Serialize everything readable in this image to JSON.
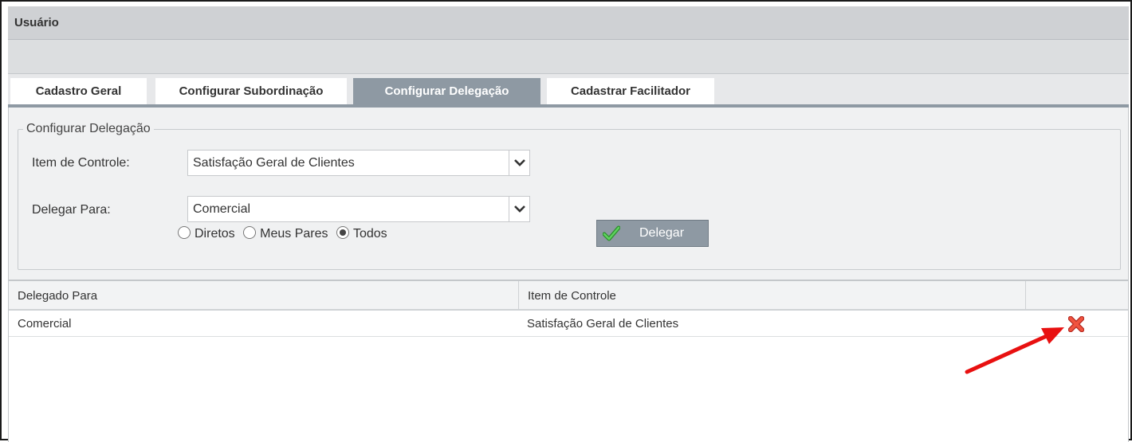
{
  "panel": {
    "title": "Usuário"
  },
  "tabs": [
    {
      "label": "Cadastro Geral",
      "active": false
    },
    {
      "label": "Configurar Subordinação",
      "active": false
    },
    {
      "label": "Configurar Delegação",
      "active": true
    },
    {
      "label": "Cadastrar Facilitador",
      "active": false
    }
  ],
  "form": {
    "legend": "Configurar Delegação",
    "item_label": "Item de Controle:",
    "item_value": "Satisfação Geral de Clientes",
    "delegar_label": "Delegar Para:",
    "delegar_value": "Comercial",
    "radios": [
      {
        "label": "Diretos",
        "checked": false
      },
      {
        "label": "Meus Pares",
        "checked": false
      },
      {
        "label": "Todos",
        "checked": true
      }
    ],
    "delegar_button": "Delegar"
  },
  "grid": {
    "columns": [
      "Delegado Para",
      "Item de Controle",
      ""
    ],
    "rows": [
      {
        "delegado_para": "Comercial",
        "item_de_controle": "Satisfação Geral de Clientes"
      }
    ]
  },
  "icons": {
    "dropdown": "chevron-down-icon",
    "button": "checkmark-icon",
    "row_action": "delete-x-icon",
    "annotation": "red-arrow-annotation"
  },
  "colors": {
    "active_tab": "#8e99a3",
    "check_green": "#3db33d",
    "delete_red": "#e8453c",
    "annotation_red": "#e81010"
  }
}
